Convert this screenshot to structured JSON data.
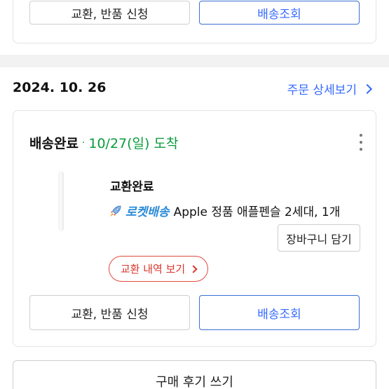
{
  "top_card": {
    "exchange_return_label": "교환, 반품 신청",
    "tracking_label": "배송조회"
  },
  "order": {
    "date": "2024. 10. 26",
    "detail_link": "주문 상세보기",
    "status": "배송완료",
    "arrival": "10/27(일) 도착",
    "item": {
      "exchange_status": "교환완료",
      "rocket_label": "로켓배송",
      "name": "Apple 정품 애플펜슬 2세대, 1개",
      "cart_label": "장바구니 담기",
      "exchange_detail_label": "교환 내역 보기"
    },
    "exchange_return_label": "교환, 반품 신청",
    "tracking_label": "배송조회"
  },
  "review_label": "구매 후기 쓰기",
  "colors": {
    "accent_blue": "#346aff",
    "arrival_green": "#0a9b3c",
    "exchange_red": "#d9352b",
    "rocket_blue": "#2a8bd8"
  },
  "icons": {
    "rocket": "rocket-icon",
    "chevron": "chevron-right-icon",
    "more": "more-vertical-icon"
  }
}
